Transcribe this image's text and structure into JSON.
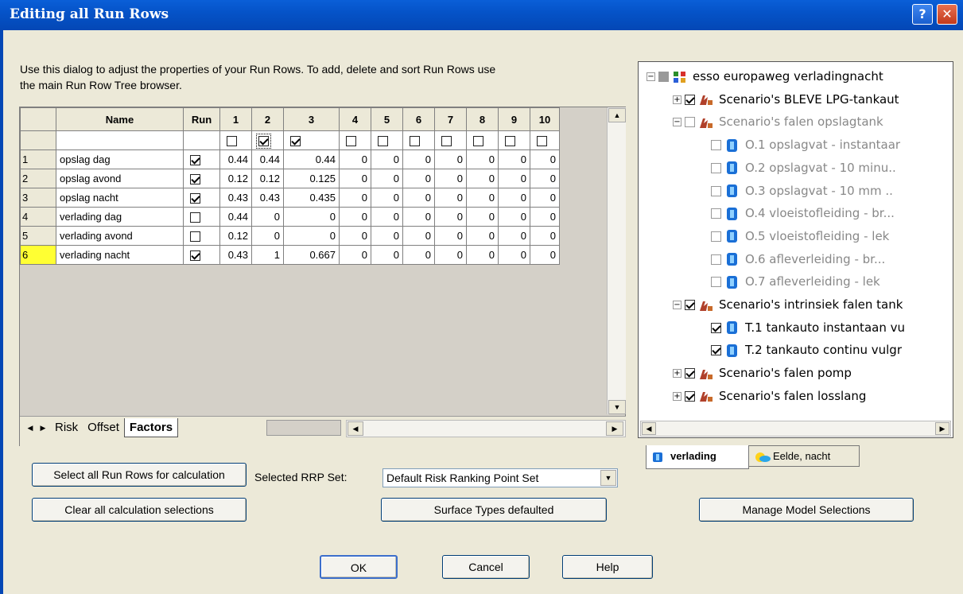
{
  "window": {
    "title": "Editing all Run Rows",
    "help_glyph": "?",
    "close_glyph": "✕"
  },
  "description": "Use this dialog to adjust the properties of your Run Rows. To add, delete and sort Run Rows use the main Run Row Tree browser.",
  "grid": {
    "headers": [
      "Name",
      "Run",
      "1",
      "2",
      "3",
      "4",
      "5",
      "6",
      "7",
      "8",
      "9",
      "10"
    ],
    "factor_checks": [
      false,
      true,
      true,
      false,
      false,
      false,
      false,
      false,
      false,
      false
    ],
    "rows": [
      {
        "index": "1",
        "name": "opslag dag",
        "run": true,
        "values": [
          "0.44",
          "0.44",
          "0.44",
          "0",
          "0",
          "0",
          "0",
          "0",
          "0",
          "0"
        ]
      },
      {
        "index": "2",
        "name": "opslag avond",
        "run": true,
        "values": [
          "0.12",
          "0.12",
          "0.125",
          "0",
          "0",
          "0",
          "0",
          "0",
          "0",
          "0"
        ]
      },
      {
        "index": "3",
        "name": "opslag nacht",
        "run": true,
        "values": [
          "0.43",
          "0.43",
          "0.435",
          "0",
          "0",
          "0",
          "0",
          "0",
          "0",
          "0"
        ]
      },
      {
        "index": "4",
        "name": "verlading dag",
        "run": false,
        "values": [
          "0.44",
          "0",
          "0",
          "0",
          "0",
          "0",
          "0",
          "0",
          "0",
          "0"
        ]
      },
      {
        "index": "5",
        "name": "verlading avond",
        "run": false,
        "values": [
          "0.12",
          "0",
          "0",
          "0",
          "0",
          "0",
          "0",
          "0",
          "0",
          "0"
        ]
      },
      {
        "index": "6",
        "name": "verlading nacht",
        "run": true,
        "values": [
          "0.43",
          "1",
          "0.667",
          "0",
          "0",
          "0",
          "0",
          "0",
          "0",
          "0"
        ]
      }
    ],
    "selected_row": "6",
    "tabs": [
      "Risk",
      "Offset",
      "Factors"
    ],
    "active_tab": "Factors"
  },
  "tree": {
    "nodes": [
      {
        "level": 0,
        "expander": "−",
        "check": "filled",
        "icon": "group-icon",
        "label": "esso europaweg verladingnacht",
        "disabled": false
      },
      {
        "level": 1,
        "expander": "+",
        "check": "on",
        "icon": "scenario-icon",
        "label": "Scenario's BLEVE LPG-tankaut",
        "disabled": false
      },
      {
        "level": 1,
        "expander": "−",
        "check": "off",
        "icon": "scenario-icon",
        "label": "Scenario's falen opslagtank",
        "disabled": true
      },
      {
        "level": 2,
        "expander": "",
        "check": "off",
        "icon": "model-icon",
        "label": "O.1 opslagvat - instantaar",
        "disabled": true
      },
      {
        "level": 2,
        "expander": "",
        "check": "off",
        "icon": "model-icon",
        "label": "O.2 opslagvat - 10 minu..",
        "disabled": true
      },
      {
        "level": 2,
        "expander": "",
        "check": "off",
        "icon": "model-icon",
        "label": "O.3 opslagvat - 10 mm ..",
        "disabled": true
      },
      {
        "level": 2,
        "expander": "",
        "check": "off",
        "icon": "model-icon",
        "label": "O.4 vloeistofleiding - br...",
        "disabled": true
      },
      {
        "level": 2,
        "expander": "",
        "check": "off",
        "icon": "model-icon",
        "label": "O.5 vloeistofleiding - lek",
        "disabled": true
      },
      {
        "level": 2,
        "expander": "",
        "check": "off",
        "icon": "model-icon",
        "label": "O.6 afleverleiding - br...",
        "disabled": true
      },
      {
        "level": 2,
        "expander": "",
        "check": "off",
        "icon": "model-icon",
        "label": "O.7 afleverleiding - lek",
        "disabled": true
      },
      {
        "level": 1,
        "expander": "−",
        "check": "on",
        "icon": "scenario-icon",
        "label": "Scenario's intrinsiek falen tank",
        "disabled": false
      },
      {
        "level": 2,
        "expander": "",
        "check": "on",
        "icon": "model-icon",
        "label": "T.1 tankauto instantaan vu",
        "disabled": false
      },
      {
        "level": 2,
        "expander": "",
        "check": "on",
        "icon": "model-icon",
        "label": "T.2 tankauto continu vulgr",
        "disabled": false
      },
      {
        "level": 1,
        "expander": "+",
        "check": "on",
        "icon": "scenario-icon",
        "label": "Scenario's falen pomp",
        "disabled": false
      },
      {
        "level": 1,
        "expander": "+",
        "check": "on",
        "icon": "scenario-icon",
        "label": "Scenario's falen losslang",
        "disabled": false
      }
    ],
    "tabs": [
      "verlading",
      "Eelde, nacht"
    ]
  },
  "buttons": {
    "select_all": "Select all Run Rows for calculation",
    "clear_all": "Clear all calculation selections",
    "surface_types": "Surface Types defaulted",
    "manage_models": "Manage Model Selections",
    "ok": "OK",
    "cancel": "Cancel",
    "help": "Help"
  },
  "rrp": {
    "label": "Selected RRP Set:",
    "value": "Default Risk Ranking Point Set"
  },
  "colors": {
    "titlebar": "#0553c8",
    "selected_row_header": "#ffff33",
    "dialog_bg": "#ece9d8"
  }
}
